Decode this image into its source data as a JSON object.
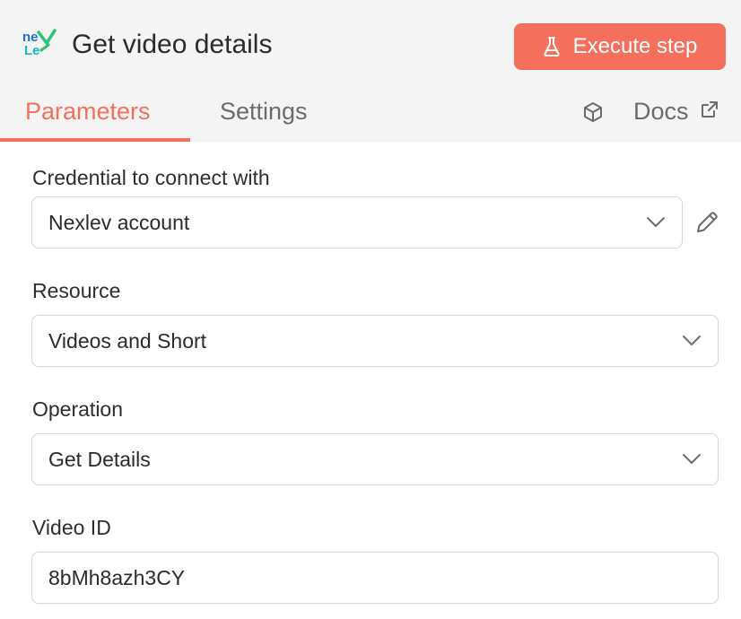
{
  "header": {
    "logo_icon": "nexlev-logo-icon",
    "title": "Get video details",
    "execute_button_label": "Execute step",
    "execute_icon": "flask-icon",
    "accent_color": "#f4705c"
  },
  "tabs": [
    {
      "label": "Parameters",
      "active": true
    },
    {
      "label": "Settings",
      "active": false
    }
  ],
  "docs": {
    "label": "Docs",
    "icon": "external-link-icon",
    "extra_icon": "cube-icon"
  },
  "fields": {
    "credential": {
      "label": "Credential to connect with",
      "value": "Nexlev account",
      "edit_icon": "pencil-icon"
    },
    "resource": {
      "label": "Resource",
      "value": "Videos and Short"
    },
    "operation": {
      "label": "Operation",
      "value": "Get Details"
    },
    "video_id": {
      "label": "Video ID",
      "value": "8bMh8azh3CY"
    }
  }
}
